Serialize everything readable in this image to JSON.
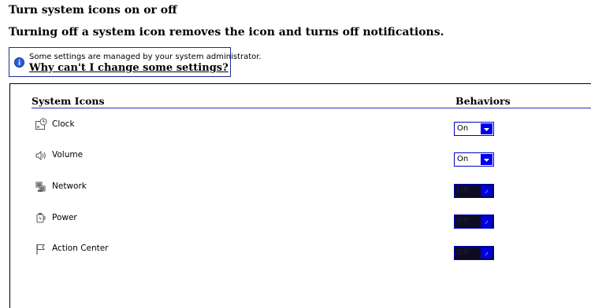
{
  "header": {
    "title": "Turn system icons on or off",
    "subtitle": "Turning off a system icon removes the icon and turns off notifications."
  },
  "notice": {
    "icon": "info-icon",
    "text": "Some settings are managed by your system administrator.",
    "link": "Why can't I change some settings?"
  },
  "table": {
    "col_icons": "System Icons",
    "col_behaviors": "Behaviors",
    "rows": [
      {
        "label": "Clock",
        "icon": "clock-icon",
        "value": "On",
        "enabled": true
      },
      {
        "label": "Volume",
        "icon": "volume-icon",
        "value": "On",
        "enabled": true
      },
      {
        "label": "Network",
        "icon": "network-icon",
        "value": "Off",
        "enabled": false
      },
      {
        "label": "Power",
        "icon": "power-icon",
        "value": "Off",
        "enabled": false
      },
      {
        "label": "Action Center",
        "icon": "action-center-icon",
        "value": "Off",
        "enabled": false
      }
    ]
  },
  "colors": {
    "accent": "#0000f0",
    "border": "#1b2a9c",
    "disabled_fill": "#0c0c22"
  }
}
